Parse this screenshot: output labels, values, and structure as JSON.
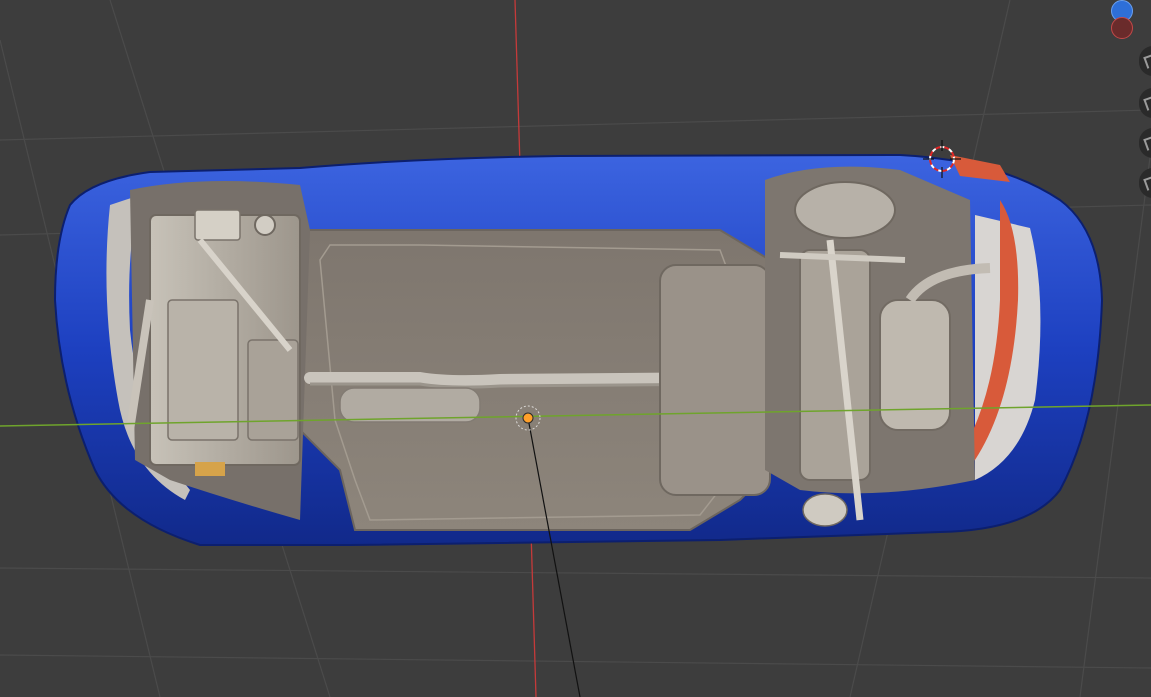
{
  "viewport": {
    "background": "#3d3d3d",
    "grid_color": "#4a4a4a",
    "x_axis_color": "#6fa42c",
    "y_axis_color": "#c53a3a"
  },
  "model": {
    "body_color": "#1f45c9",
    "chassis_color": "#8a8178",
    "accent_color": "#d85a3a"
  },
  "gizmo": {
    "z_axis_color": "#2e6fd8",
    "neg_x_axis_color": "#c54848"
  },
  "nav_tools": [
    {
      "icon": "zoom-icon"
    },
    {
      "icon": "pan-hand-icon"
    },
    {
      "icon": "camera-icon"
    },
    {
      "icon": "perspective-grid-icon"
    }
  ]
}
